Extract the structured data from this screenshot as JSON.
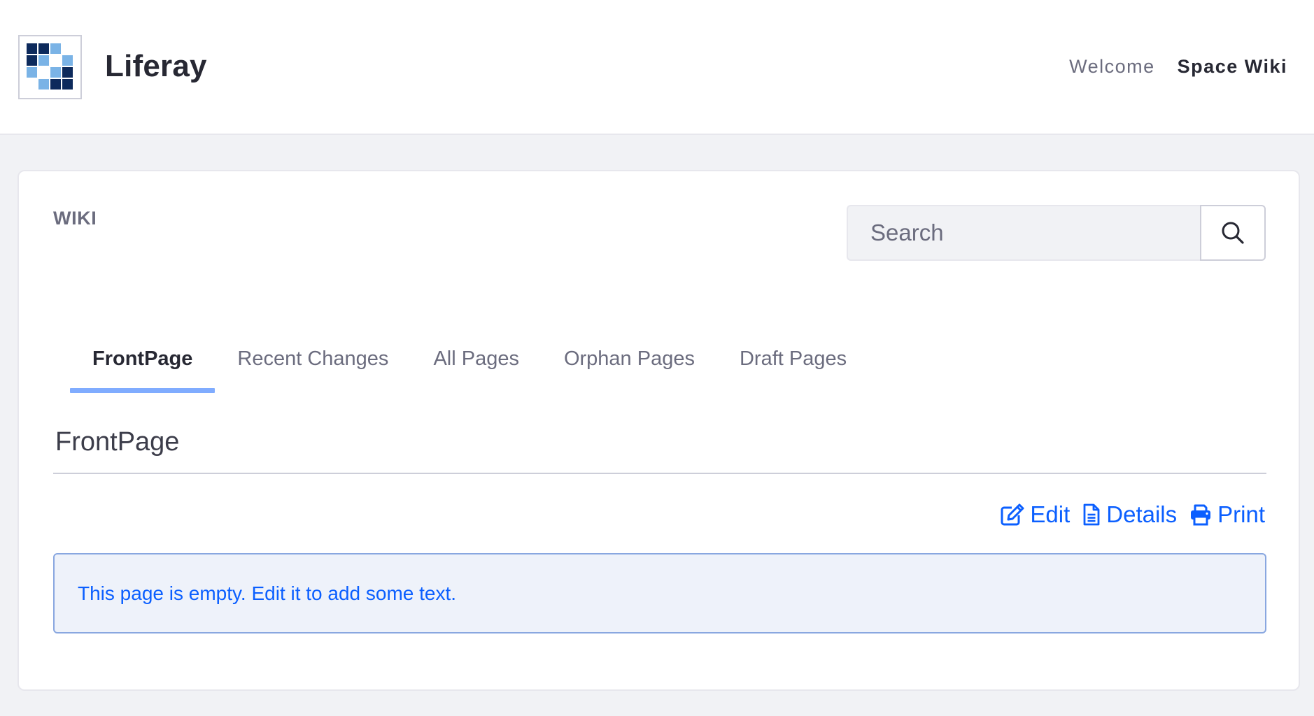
{
  "header": {
    "site_name": "Liferay",
    "nav": [
      {
        "label": "Welcome",
        "active": false
      },
      {
        "label": "Space Wiki",
        "active": true
      }
    ]
  },
  "portlet": {
    "title": "WIKI",
    "search": {
      "placeholder": "Search",
      "value": ""
    },
    "tabs": [
      {
        "label": "FrontPage",
        "active": true
      },
      {
        "label": "Recent Changes",
        "active": false
      },
      {
        "label": "All Pages",
        "active": false
      },
      {
        "label": "Orphan Pages",
        "active": false
      },
      {
        "label": "Draft Pages",
        "active": false
      }
    ],
    "page_title": "FrontPage",
    "actions": {
      "edit_label": "Edit",
      "details_label": "Details",
      "print_label": "Print"
    },
    "empty_message": "This page is empty. Edit it to add some text."
  },
  "icons": {
    "logo": "liferay-logo-icon",
    "search": "search-icon",
    "edit": "edit-icon",
    "details": "document-icon",
    "print": "print-icon"
  },
  "colors": {
    "accent": "#0b5fff",
    "tab_indicator": "#80acff",
    "alert_bg": "#eef2fa",
    "alert_border": "#89a7e0",
    "page_bg": "#f1f2f5"
  }
}
